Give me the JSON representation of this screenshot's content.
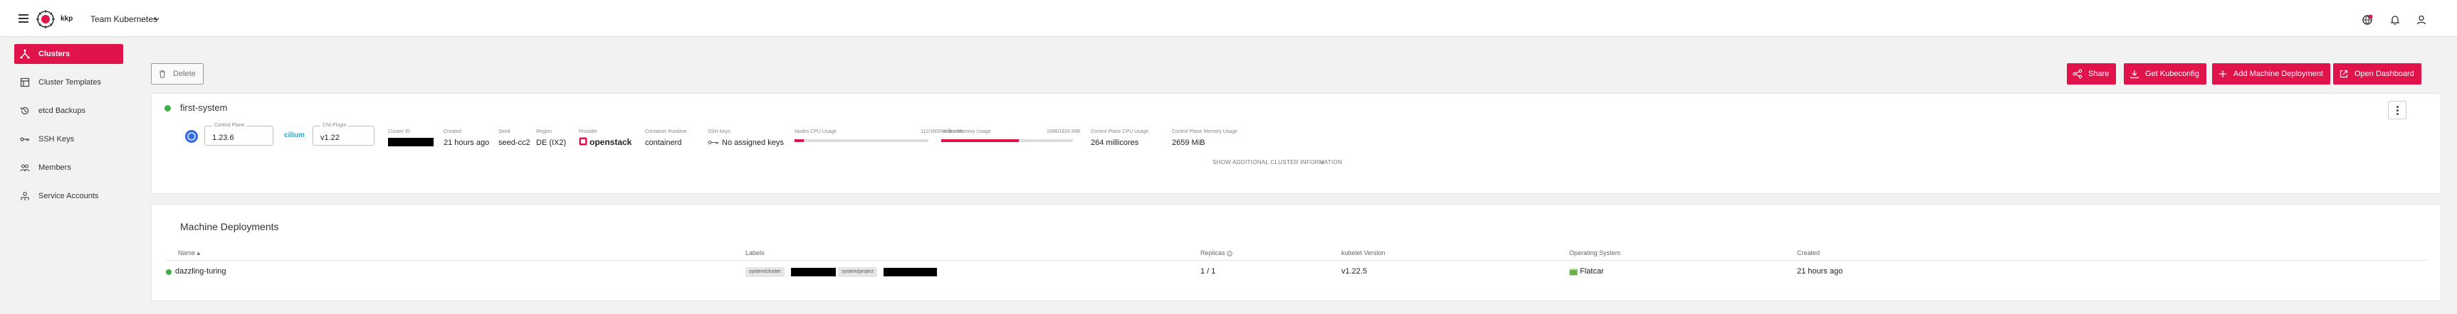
{
  "header": {
    "logo_text": "kkp",
    "project_name": "Team Kubernetes",
    "icons": [
      "menu-icon",
      "changelog-icon",
      "notifications-icon",
      "account-icon"
    ],
    "brand_color": "#e0144a"
  },
  "sidebar": {
    "items": [
      {
        "label": "Clusters",
        "icon": "clusters-icon",
        "active": true
      },
      {
        "label": "Cluster Templates",
        "icon": "templates-icon",
        "active": false
      },
      {
        "label": "etcd Backups",
        "icon": "backup-icon",
        "active": false
      },
      {
        "label": "SSH Keys",
        "icon": "key-icon",
        "active": false
      },
      {
        "label": "Members",
        "icon": "members-icon",
        "active": false
      },
      {
        "label": "Service Accounts",
        "icon": "service-account-icon",
        "active": false
      }
    ]
  },
  "toolbar": {
    "delete_label": "Delete",
    "share_label": "Share",
    "kubeconfig_label": "Get Kubeconfig",
    "add_md_label": "Add Machine Deployment",
    "dashboard_label": "Open Dashboard"
  },
  "cluster": {
    "name": "first-system",
    "status": "running",
    "control_plane_label": "Control Plane",
    "control_plane_value": "1.23.6",
    "cni_label": "CNI Plugin",
    "cni_logo": "cilium",
    "cni_value": "v1.22",
    "cluster_id_label": "Cluster ID",
    "created_label": "Created",
    "created_value": "21 hours ago",
    "seed_label": "Seed",
    "seed_value": "seed-cc2",
    "region_label": "Region",
    "region_value": "DE (IX2)",
    "provider_label": "Provider",
    "provider_value": "openstack",
    "runtime_label": "Container Runtime",
    "runtime_value": "containerd",
    "ssh_label": "SSH Keys",
    "ssh_value": "No assigned keys",
    "nodes_cpu_label": "Nodes CPU Usage",
    "nodes_cpu_value": "112/1600 millicores",
    "nodes_cpu_fraction": 0.07,
    "nodes_mem_label": "Nodes Memory Usage",
    "nodes_mem_value": "1086/1826 MiB",
    "nodes_mem_fraction": 0.59,
    "cp_cpu_label": "Control Plane CPU Usage",
    "cp_cpu_value": "264 millicores",
    "cp_mem_label": "Control Plane Memory Usage",
    "cp_mem_value": "2659 MiB",
    "show_more_label": "SHOW ADDITIONAL CLUSTER INFORMATION"
  },
  "machine_deployments": {
    "title": "Machine Deployments",
    "columns": {
      "name": "Name",
      "labels": "Labels",
      "replicas": "Replicas",
      "kubelet": "kubelet Version",
      "os": "Operating System",
      "created": "Created"
    },
    "rows": [
      {
        "name": "dazzling-turing",
        "label_1": "system/cluster",
        "label_2": "system/project",
        "replicas": "1 / 1",
        "kubelet": "v1.22.5",
        "os": "Flatcar",
        "created": "21 hours ago"
      }
    ]
  }
}
